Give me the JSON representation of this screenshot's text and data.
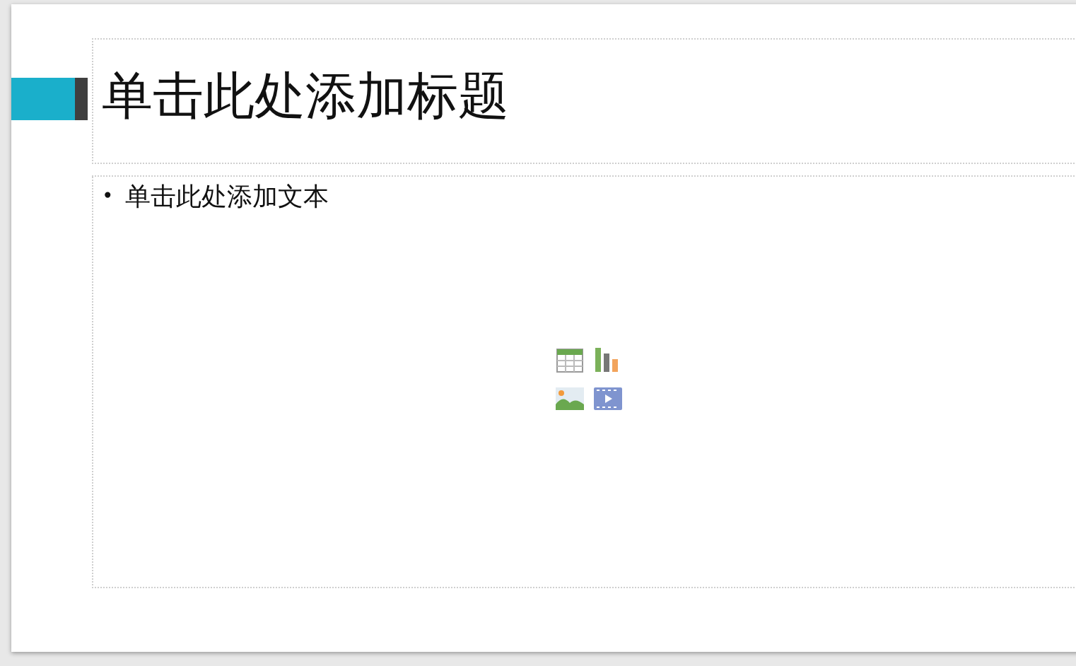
{
  "slide": {
    "title_placeholder": "单击此处添加标题",
    "body_placeholder": {
      "bullet": "•",
      "text": "单击此处添加文本"
    }
  }
}
